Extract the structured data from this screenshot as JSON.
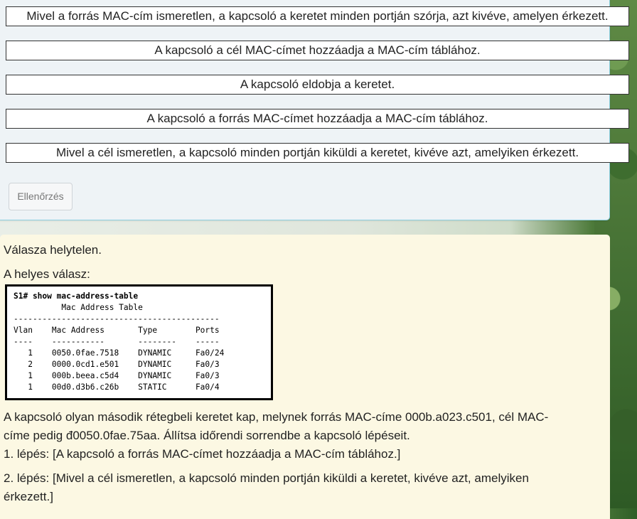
{
  "question": {
    "options": [
      "Mivel a forrás MAC-cím ismeretlen, a kapcsoló a keretet minden portján szórja, azt kivéve, amelyen érkezett.",
      "A kapcsoló a cél MAC-címet hozzáadja a MAC-cím táblához.",
      "A kapcsoló eldobja a keretet.",
      "A kapcsoló a forrás MAC-címet hozzáadja a MAC-cím táblához.",
      "Mivel a cél ismeretlen, a kapcsoló minden portján kiküldi a keretet, kivéve azt, amelyiken érkezett."
    ],
    "check_button_label": "Ellenőrzés"
  },
  "feedback": {
    "result": "Válasza helytelen.",
    "correct_answer_label": "A helyes válasz:",
    "cli": {
      "command": "S1# show mac-address-table",
      "table_title": "          Mac Address Table",
      "separator": "-------------------------------------------",
      "header": "Vlan    Mac Address       Type        Ports",
      "header_underline": "----    -----------       --------    -----",
      "rows": [
        "   1    0050.0fae.7518    DYNAMIC     Fa0/24",
        "   2    0000.0cd1.e501    DYNAMIC     Fa0/3",
        "   1    000b.beea.c5d4    DYNAMIC     Fa0/3",
        "   1    00d0.d3b6.c26b    STATIC      Fa0/4"
      ]
    },
    "scenario_line1": "A kapcsoló olyan második rétegbeli keretet kap, melynek forrás MAC-címe 000b.a023.c501, cél MAC-",
    "scenario_line2": "címe pedig đ0050.0fae.75aa. Állítsa időrendi sorrendbe a kapcsoló lépéseit.",
    "step1": "1. lépés: [A kapcsoló a forrás MAC-címet hozzáadja a MAC-cím táblához.]",
    "step2_line1": "2. lépés: [Mivel a cél ismeretlen, a kapcsoló minden portján kiküldi a keretet, kivéve azt, amelyiken",
    "step2_line2": "érkezett.]"
  }
}
